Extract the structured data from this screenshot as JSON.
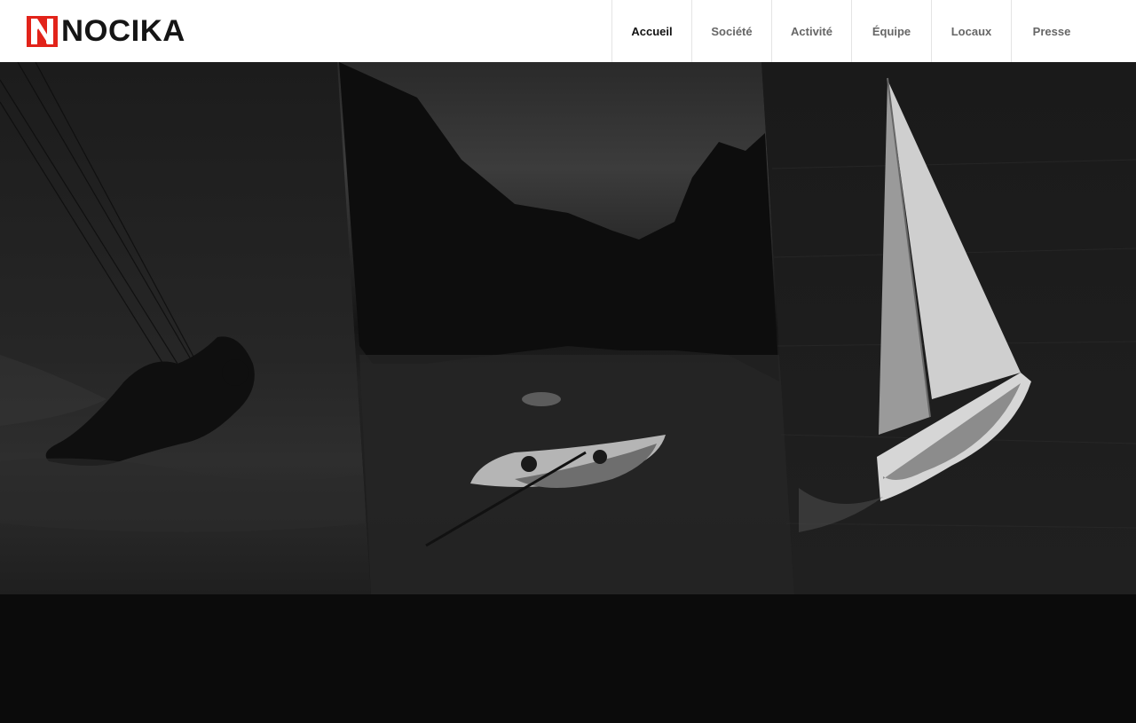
{
  "brand": {
    "name": "NOCIKA",
    "accent": "#e2231a",
    "logo_icon": "nocika-n-mark-icon"
  },
  "nav": {
    "items": [
      {
        "label": "Accueil",
        "active": true
      },
      {
        "label": "Société",
        "active": false
      },
      {
        "label": "Activité",
        "active": false
      },
      {
        "label": "Équipe",
        "active": false
      },
      {
        "label": "Locaux",
        "active": false
      },
      {
        "label": "Presse",
        "active": false
      }
    ]
  },
  "hero": {
    "panels": [
      {
        "subject": "kitesurfer-photo"
      },
      {
        "subject": "kayak-lagoon-photo"
      },
      {
        "subject": "sailboat-photo"
      }
    ]
  },
  "colors": {
    "header_bg": "#ffffff",
    "page_bg": "#0b0b0b",
    "nav_active": "#111111",
    "nav_inactive": "#666666"
  }
}
